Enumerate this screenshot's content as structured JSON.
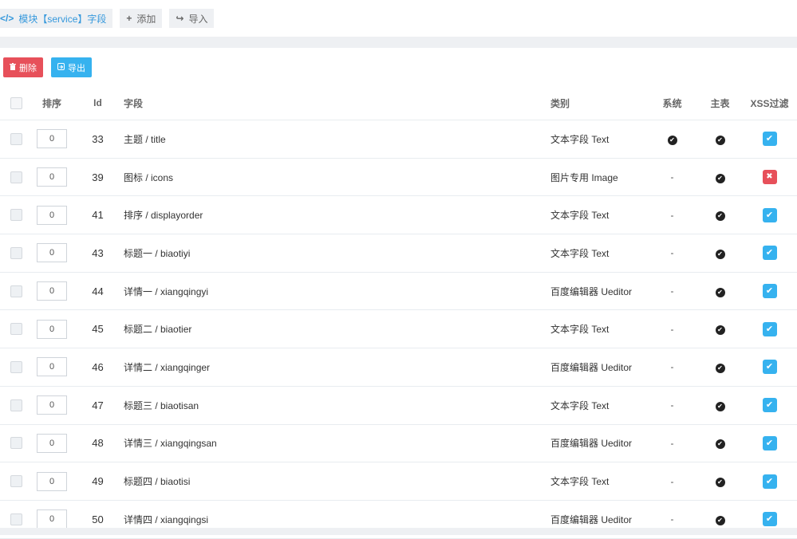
{
  "tabs": [
    {
      "icon": "</>",
      "label": "模块【service】字段",
      "active": true
    },
    {
      "icon": "+",
      "label": "添加",
      "active": false
    },
    {
      "icon": "↪",
      "label": "导入",
      "active": false
    }
  ],
  "actions": {
    "delete_label": "删除",
    "export_label": "导出"
  },
  "table": {
    "headers": {
      "order": "排序",
      "id": "Id",
      "field": "字段",
      "type": "类别",
      "system": "系统",
      "primary": "主表",
      "xss": "XSS过滤"
    },
    "rows": [
      {
        "order": "0",
        "id": "33",
        "field": "主题 / title",
        "type": "文本字段 Text",
        "system": true,
        "primary": true,
        "xss": true
      },
      {
        "order": "0",
        "id": "39",
        "field": "图标 / icons",
        "type": "图片专用 Image",
        "system": false,
        "primary": true,
        "xss": false
      },
      {
        "order": "0",
        "id": "41",
        "field": "排序 / displayorder",
        "type": "文本字段 Text",
        "system": false,
        "primary": true,
        "xss": true
      },
      {
        "order": "0",
        "id": "43",
        "field": "标题一 / biaotiyi",
        "type": "文本字段 Text",
        "system": false,
        "primary": true,
        "xss": true
      },
      {
        "order": "0",
        "id": "44",
        "field": "详情一 / xiangqingyi",
        "type": "百度编辑器 Ueditor",
        "system": false,
        "primary": true,
        "xss": true
      },
      {
        "order": "0",
        "id": "45",
        "field": "标题二 / biaotier",
        "type": "文本字段 Text",
        "system": false,
        "primary": true,
        "xss": true
      },
      {
        "order": "0",
        "id": "46",
        "field": "详情二 / xiangqinger",
        "type": "百度编辑器 Ueditor",
        "system": false,
        "primary": true,
        "xss": true
      },
      {
        "order": "0",
        "id": "47",
        "field": "标题三 / biaotisan",
        "type": "文本字段 Text",
        "system": false,
        "primary": true,
        "xss": true
      },
      {
        "order": "0",
        "id": "48",
        "field": "详情三 / xiangqingsan",
        "type": "百度编辑器 Ueditor",
        "system": false,
        "primary": true,
        "xss": true
      },
      {
        "order": "0",
        "id": "49",
        "field": "标题四 / biaotisi",
        "type": "文本字段 Text",
        "system": false,
        "primary": true,
        "xss": true
      },
      {
        "order": "0",
        "id": "50",
        "field": "详情四 / xiangqingsi",
        "type": "百度编辑器 Ueditor",
        "system": false,
        "primary": true,
        "xss": true
      }
    ],
    "dash": "-",
    "check_glyph": "✔",
    "cross_glyph": "✖"
  },
  "colors": {
    "accent_blue": "#36b2ef",
    "danger_red": "#e7505a",
    "link_blue": "#3598dc"
  }
}
